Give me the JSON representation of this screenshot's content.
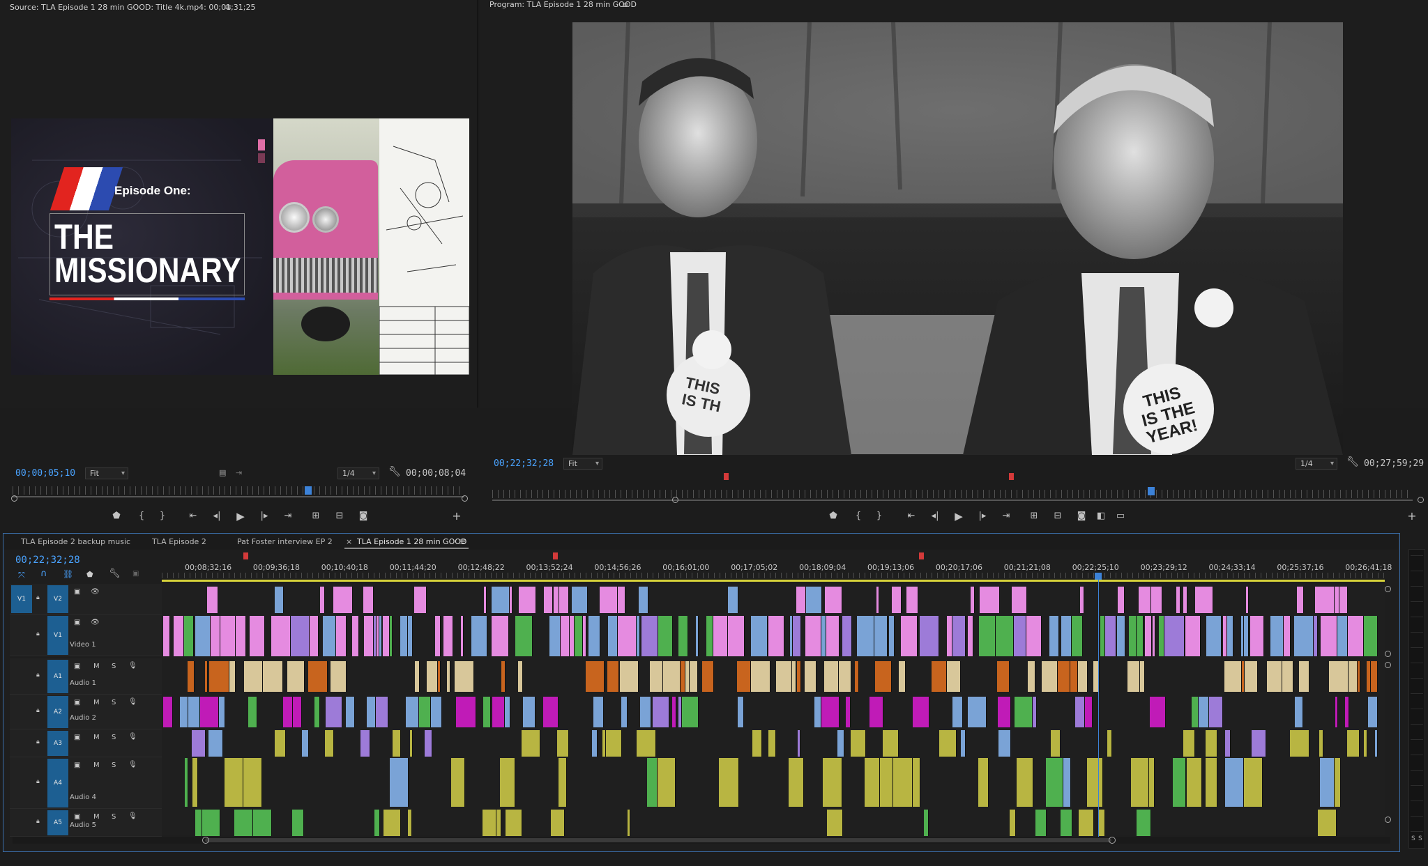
{
  "source": {
    "title": "Source: TLA Episode 1 28 min GOOD: Title 4k.mp4: 00;01;31;25",
    "timecode": "00;00;05;10",
    "zoom": "Fit",
    "resolution": "1/4",
    "duration": "00;00;08;04",
    "title_card": {
      "episode": "Episode One:",
      "line1": "THE",
      "line2": "MISSIONARY"
    }
  },
  "program": {
    "title": "Program: TLA Episode 1 28 min GOOD",
    "timecode": "00;22;32;28",
    "zoom": "Fit",
    "resolution": "1/4",
    "duration": "00;27;59;29"
  },
  "timeline": {
    "tabs": [
      {
        "label": "TLA Episode 2 backup music"
      },
      {
        "label": "TLA Episode 2"
      },
      {
        "label": "Pat Foster interview EP 2"
      },
      {
        "label": "TLA Episode 1 28 min GOOD"
      }
    ],
    "timecode": "00;22;32;28",
    "ruler_labels": [
      "00;08;32;16",
      "00;09;36;18",
      "00;10;40;18",
      "00;11;44;20",
      "00;12;48;22",
      "00;13;52;24",
      "00;14;56;26",
      "00;16;01;00",
      "00;17;05;02",
      "00;18;09;04",
      "00;19;13;06",
      "00;20;17;06",
      "00;21;21;08",
      "00;22;25;10",
      "00;23;29;12",
      "00;24;33;14",
      "00;25;37;16",
      "00;26;41;18"
    ],
    "tracks": [
      {
        "id": "V1",
        "tag": "V2",
        "name": ""
      },
      {
        "id": "",
        "tag": "V1",
        "name": "Video 1"
      },
      {
        "id": "",
        "tag": "A1",
        "name": "Audio 1"
      },
      {
        "id": "",
        "tag": "A2",
        "name": "Audio 2"
      },
      {
        "id": "",
        "tag": "A3",
        "name": ""
      },
      {
        "id": "",
        "tag": "A4",
        "name": "Audio 4"
      },
      {
        "id": "",
        "tag": "A5",
        "name": "Audio 5"
      }
    ],
    "mute_label": "M",
    "solo_label": "S"
  },
  "colors": {
    "accent": "#4aa3ff",
    "pink": "#e58be0",
    "blue": "#7aa3d6",
    "green": "#4fb04f",
    "tan": "#d8c79a",
    "olive": "#b8b542",
    "orange": "#c8641e",
    "magenta": "#c01bb7",
    "purple": "#9d7bd8"
  }
}
